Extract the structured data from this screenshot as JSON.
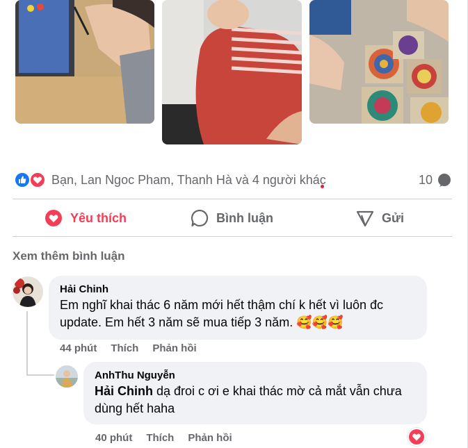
{
  "photos": [
    {
      "name": "photo-child-tablet"
    },
    {
      "name": "photo-child-red-shirt"
    },
    {
      "name": "photo-child-paintings"
    }
  ],
  "reactions": {
    "names": "Bạn, Lan Ngoc Pham, Thanh Hà và 4 người khác",
    "comment_count": "10",
    "icons": [
      "like-icon",
      "love-icon"
    ]
  },
  "actions": {
    "like": "Yêu thích",
    "comment": "Bình luận",
    "share": "Gửi"
  },
  "see_more": "Xem thêm bình luận",
  "comments": [
    {
      "author": "Hải Chinh",
      "text": "Em nghĩ khai thác 6 năm mới hết thậm chí k hết vì luôn đc update. Em hết 3 năm sẽ mua tiếp 3 năm.",
      "emoji": "🥰🥰🥰",
      "time": "44 phút",
      "like": "Thích",
      "reply": "Phản hồi"
    },
    {
      "author": "AnhThu Nguyễn",
      "mention": "Hải Chinh",
      "text": " dạ đroi c ơi e khai thác mờ cả mắt vẫn chưa dùng hết haha",
      "time": "40 phút",
      "like": "Thích",
      "reply": "Phản hồi"
    }
  ],
  "colors": {
    "accent": "#f33e58",
    "like_blue": "#1877f2",
    "muted": "#65676b",
    "bubble": "#f0f2f5"
  }
}
